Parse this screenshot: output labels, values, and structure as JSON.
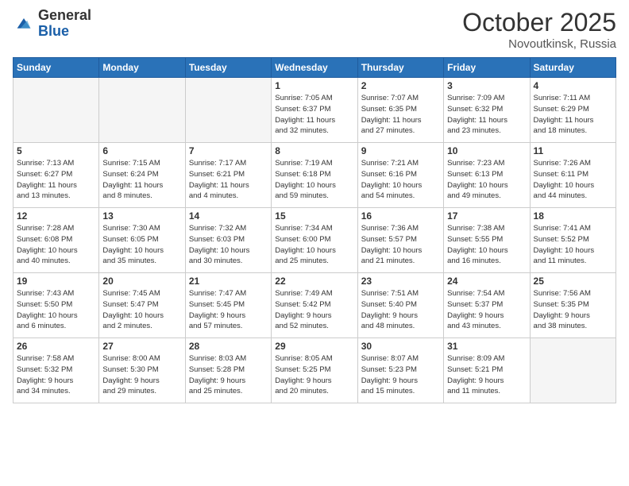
{
  "header": {
    "logo_general": "General",
    "logo_blue": "Blue",
    "month": "October 2025",
    "location": "Novoutkinsk, Russia"
  },
  "weekdays": [
    "Sunday",
    "Monday",
    "Tuesday",
    "Wednesday",
    "Thursday",
    "Friday",
    "Saturday"
  ],
  "weeks": [
    [
      {
        "day": "",
        "info": ""
      },
      {
        "day": "",
        "info": ""
      },
      {
        "day": "",
        "info": ""
      },
      {
        "day": "1",
        "info": "Sunrise: 7:05 AM\nSunset: 6:37 PM\nDaylight: 11 hours\nand 32 minutes."
      },
      {
        "day": "2",
        "info": "Sunrise: 7:07 AM\nSunset: 6:35 PM\nDaylight: 11 hours\nand 27 minutes."
      },
      {
        "day": "3",
        "info": "Sunrise: 7:09 AM\nSunset: 6:32 PM\nDaylight: 11 hours\nand 23 minutes."
      },
      {
        "day": "4",
        "info": "Sunrise: 7:11 AM\nSunset: 6:29 PM\nDaylight: 11 hours\nand 18 minutes."
      }
    ],
    [
      {
        "day": "5",
        "info": "Sunrise: 7:13 AM\nSunset: 6:27 PM\nDaylight: 11 hours\nand 13 minutes."
      },
      {
        "day": "6",
        "info": "Sunrise: 7:15 AM\nSunset: 6:24 PM\nDaylight: 11 hours\nand 8 minutes."
      },
      {
        "day": "7",
        "info": "Sunrise: 7:17 AM\nSunset: 6:21 PM\nDaylight: 11 hours\nand 4 minutes."
      },
      {
        "day": "8",
        "info": "Sunrise: 7:19 AM\nSunset: 6:18 PM\nDaylight: 10 hours\nand 59 minutes."
      },
      {
        "day": "9",
        "info": "Sunrise: 7:21 AM\nSunset: 6:16 PM\nDaylight: 10 hours\nand 54 minutes."
      },
      {
        "day": "10",
        "info": "Sunrise: 7:23 AM\nSunset: 6:13 PM\nDaylight: 10 hours\nand 49 minutes."
      },
      {
        "day": "11",
        "info": "Sunrise: 7:26 AM\nSunset: 6:11 PM\nDaylight: 10 hours\nand 44 minutes."
      }
    ],
    [
      {
        "day": "12",
        "info": "Sunrise: 7:28 AM\nSunset: 6:08 PM\nDaylight: 10 hours\nand 40 minutes."
      },
      {
        "day": "13",
        "info": "Sunrise: 7:30 AM\nSunset: 6:05 PM\nDaylight: 10 hours\nand 35 minutes."
      },
      {
        "day": "14",
        "info": "Sunrise: 7:32 AM\nSunset: 6:03 PM\nDaylight: 10 hours\nand 30 minutes."
      },
      {
        "day": "15",
        "info": "Sunrise: 7:34 AM\nSunset: 6:00 PM\nDaylight: 10 hours\nand 25 minutes."
      },
      {
        "day": "16",
        "info": "Sunrise: 7:36 AM\nSunset: 5:57 PM\nDaylight: 10 hours\nand 21 minutes."
      },
      {
        "day": "17",
        "info": "Sunrise: 7:38 AM\nSunset: 5:55 PM\nDaylight: 10 hours\nand 16 minutes."
      },
      {
        "day": "18",
        "info": "Sunrise: 7:41 AM\nSunset: 5:52 PM\nDaylight: 10 hours\nand 11 minutes."
      }
    ],
    [
      {
        "day": "19",
        "info": "Sunrise: 7:43 AM\nSunset: 5:50 PM\nDaylight: 10 hours\nand 6 minutes."
      },
      {
        "day": "20",
        "info": "Sunrise: 7:45 AM\nSunset: 5:47 PM\nDaylight: 10 hours\nand 2 minutes."
      },
      {
        "day": "21",
        "info": "Sunrise: 7:47 AM\nSunset: 5:45 PM\nDaylight: 9 hours\nand 57 minutes."
      },
      {
        "day": "22",
        "info": "Sunrise: 7:49 AM\nSunset: 5:42 PM\nDaylight: 9 hours\nand 52 minutes."
      },
      {
        "day": "23",
        "info": "Sunrise: 7:51 AM\nSunset: 5:40 PM\nDaylight: 9 hours\nand 48 minutes."
      },
      {
        "day": "24",
        "info": "Sunrise: 7:54 AM\nSunset: 5:37 PM\nDaylight: 9 hours\nand 43 minutes."
      },
      {
        "day": "25",
        "info": "Sunrise: 7:56 AM\nSunset: 5:35 PM\nDaylight: 9 hours\nand 38 minutes."
      }
    ],
    [
      {
        "day": "26",
        "info": "Sunrise: 7:58 AM\nSunset: 5:32 PM\nDaylight: 9 hours\nand 34 minutes."
      },
      {
        "day": "27",
        "info": "Sunrise: 8:00 AM\nSunset: 5:30 PM\nDaylight: 9 hours\nand 29 minutes."
      },
      {
        "day": "28",
        "info": "Sunrise: 8:03 AM\nSunset: 5:28 PM\nDaylight: 9 hours\nand 25 minutes."
      },
      {
        "day": "29",
        "info": "Sunrise: 8:05 AM\nSunset: 5:25 PM\nDaylight: 9 hours\nand 20 minutes."
      },
      {
        "day": "30",
        "info": "Sunrise: 8:07 AM\nSunset: 5:23 PM\nDaylight: 9 hours\nand 15 minutes."
      },
      {
        "day": "31",
        "info": "Sunrise: 8:09 AM\nSunset: 5:21 PM\nDaylight: 9 hours\nand 11 minutes."
      },
      {
        "day": "",
        "info": ""
      }
    ]
  ]
}
